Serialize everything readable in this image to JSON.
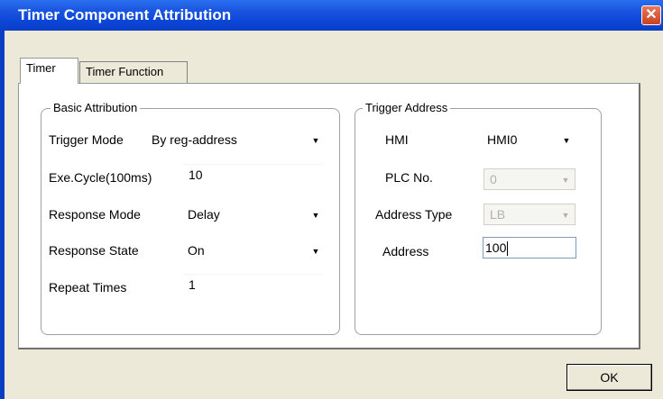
{
  "window": {
    "title": "Timer Component Attribution",
    "close_label": "✕"
  },
  "tabs": [
    {
      "label": "Timer",
      "active": true
    },
    {
      "label": "Timer Function",
      "active": false
    }
  ],
  "basic": {
    "legend": "Basic Attribution",
    "trigger_mode": {
      "label": "Trigger Mode",
      "value": "By reg-address"
    },
    "exe_cycle": {
      "label": "Exe.Cycle(100ms)",
      "value": "10"
    },
    "response_mode": {
      "label": "Response Mode",
      "value": "Delay"
    },
    "response_state": {
      "label": "Response State",
      "value": "On"
    },
    "repeat_times": {
      "label": "Repeat Times",
      "value": "1"
    }
  },
  "trigger": {
    "legend": "Trigger Address",
    "hmi": {
      "label": "HMI",
      "value": "HMI0"
    },
    "plc_no": {
      "label": "PLC No.",
      "value": "0"
    },
    "address_type": {
      "label": "Address Type",
      "value": "LB"
    },
    "address": {
      "label": "Address",
      "value": "100"
    }
  },
  "buttons": {
    "ok": "OK"
  },
  "icons": {
    "dropdown": "▼"
  }
}
